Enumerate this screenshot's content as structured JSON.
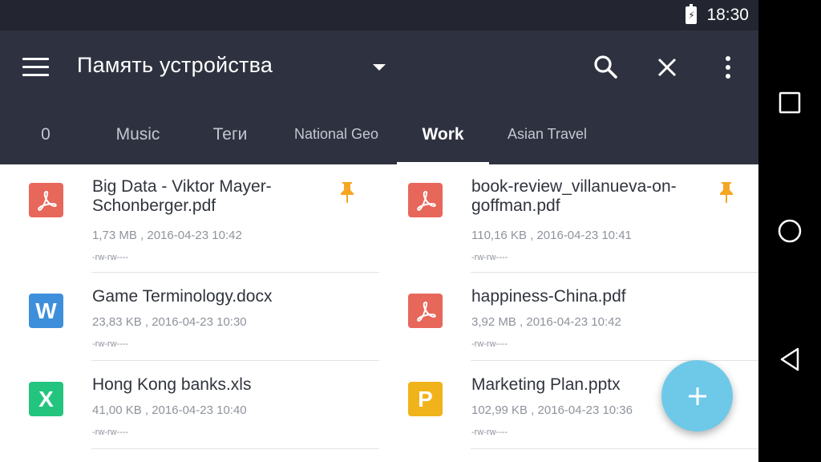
{
  "status_bar": {
    "time": "18:30"
  },
  "toolbar": {
    "title": "Память устройства",
    "icons": [
      "menu-icon",
      "dropdown-arrow-icon",
      "search-icon",
      "close-icon",
      "more-vert-icon"
    ]
  },
  "tabs": [
    {
      "label": "0"
    },
    {
      "label": "Music"
    },
    {
      "label": "Теги"
    },
    {
      "label": "National Geo"
    },
    {
      "label": "Work",
      "selected": true
    },
    {
      "label": "Asian Travel"
    }
  ],
  "files": [
    {
      "name": "Big Data - Viktor Mayer-Schonberger.pdf",
      "meta": "1,73 MB , 2016-04-23 10:42",
      "perms": "-rw-rw----",
      "type": "pdf",
      "icon_letter": "",
      "pinned": true
    },
    {
      "name": "book-review_villanueva-on-goffman.pdf",
      "meta": "110,16 KB , 2016-04-23 10:41",
      "perms": "-rw-rw----",
      "type": "pdf",
      "icon_letter": "",
      "pinned": true
    },
    {
      "name": "Game Terminology.docx",
      "meta": "23,83 KB , 2016-04-23 10:30",
      "perms": "-rw-rw----",
      "type": "docx",
      "icon_letter": "W",
      "pinned": false
    },
    {
      "name": "happiness-China.pdf",
      "meta": "3,92 MB , 2016-04-23 10:42",
      "perms": "-rw-rw----",
      "type": "pdf",
      "icon_letter": "",
      "pinned": false
    },
    {
      "name": "Hong Kong banks.xls",
      "meta": "41,00 KB , 2016-04-23 10:40",
      "perms": "-rw-rw----",
      "type": "xls",
      "icon_letter": "X",
      "pinned": false
    },
    {
      "name": "Marketing Plan.pptx",
      "meta": "102,99 KB , 2016-04-23 10:36",
      "perms": "-rw-rw----",
      "type": "pptx",
      "icon_letter": "P",
      "pinned": false
    }
  ],
  "colors": {
    "toolbar_bg": "#2e3240",
    "status_bg": "#232631",
    "pdf": "#e7675b",
    "docx": "#3d8fdb",
    "xls": "#22c47e",
    "pptx": "#f1b31c",
    "pin": "#f5a623",
    "fab": "#6ec9e9"
  },
  "fab": {
    "icon": "plus-icon"
  },
  "nav_bar": {
    "icons": [
      "recents-square-icon",
      "home-circle-icon",
      "back-triangle-icon"
    ]
  }
}
